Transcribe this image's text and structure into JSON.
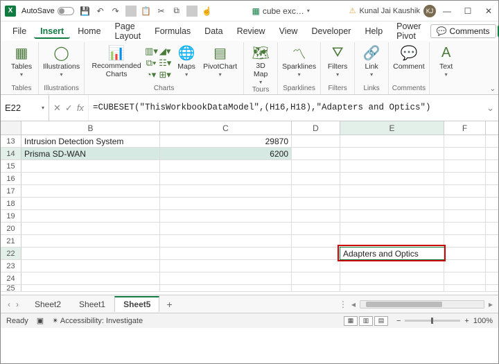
{
  "titlebar": {
    "autosave": "AutoSave",
    "doc": "cube exc…",
    "user": "Kunal Jai Kaushik",
    "initials": "KJ"
  },
  "menu": {
    "file": "File",
    "insert": "Insert",
    "home": "Home",
    "pagelayout": "Page Layout",
    "formulas": "Formulas",
    "data": "Data",
    "review": "Review",
    "view": "View",
    "developer": "Developer",
    "help": "Help",
    "powerpivot": "Power Pivot",
    "comments": "Comments"
  },
  "ribbon": {
    "tables": "Tables",
    "illustrations": "Illustrations",
    "reccharts": "Recommended\nCharts",
    "charts": "Charts",
    "maps": "Maps",
    "pivotchart": "PivotChart",
    "map3d": "3D\nMap",
    "tours": "Tours",
    "sparklines": "Sparklines",
    "filters": "Filters",
    "link": "Link",
    "links": "Links",
    "comment": "Comment",
    "commentsg": "Comments",
    "text": "Text"
  },
  "formula": {
    "cellref": "E22",
    "text": "=CUBESET(\"ThisWorkbookDataModel\",(H16,H18),\"Adapters and Optics\")"
  },
  "cols": {
    "B": "B",
    "C": "C",
    "D": "D",
    "E": "E",
    "F": "F"
  },
  "rows": {
    "13": {
      "n": "13",
      "B": "Intrusion Detection System",
      "C": "29870"
    },
    "14": {
      "n": "14",
      "B": "Prisma SD-WAN",
      "C": "6200"
    },
    "15": {
      "n": "15"
    },
    "16": {
      "n": "16"
    },
    "17": {
      "n": "17"
    },
    "18": {
      "n": "18"
    },
    "19": {
      "n": "19"
    },
    "20": {
      "n": "20"
    },
    "21": {
      "n": "21"
    },
    "22": {
      "n": "22",
      "E": "Adapters and Optics"
    },
    "23": {
      "n": "23"
    },
    "24": {
      "n": "24"
    },
    "25": {
      "n": "25"
    }
  },
  "sheets": {
    "s2": "Sheet2",
    "s1": "Sheet1",
    "s5": "Sheet5"
  },
  "status": {
    "ready": "Ready",
    "access": "Accessibility: Investigate",
    "zoom": "100%"
  }
}
